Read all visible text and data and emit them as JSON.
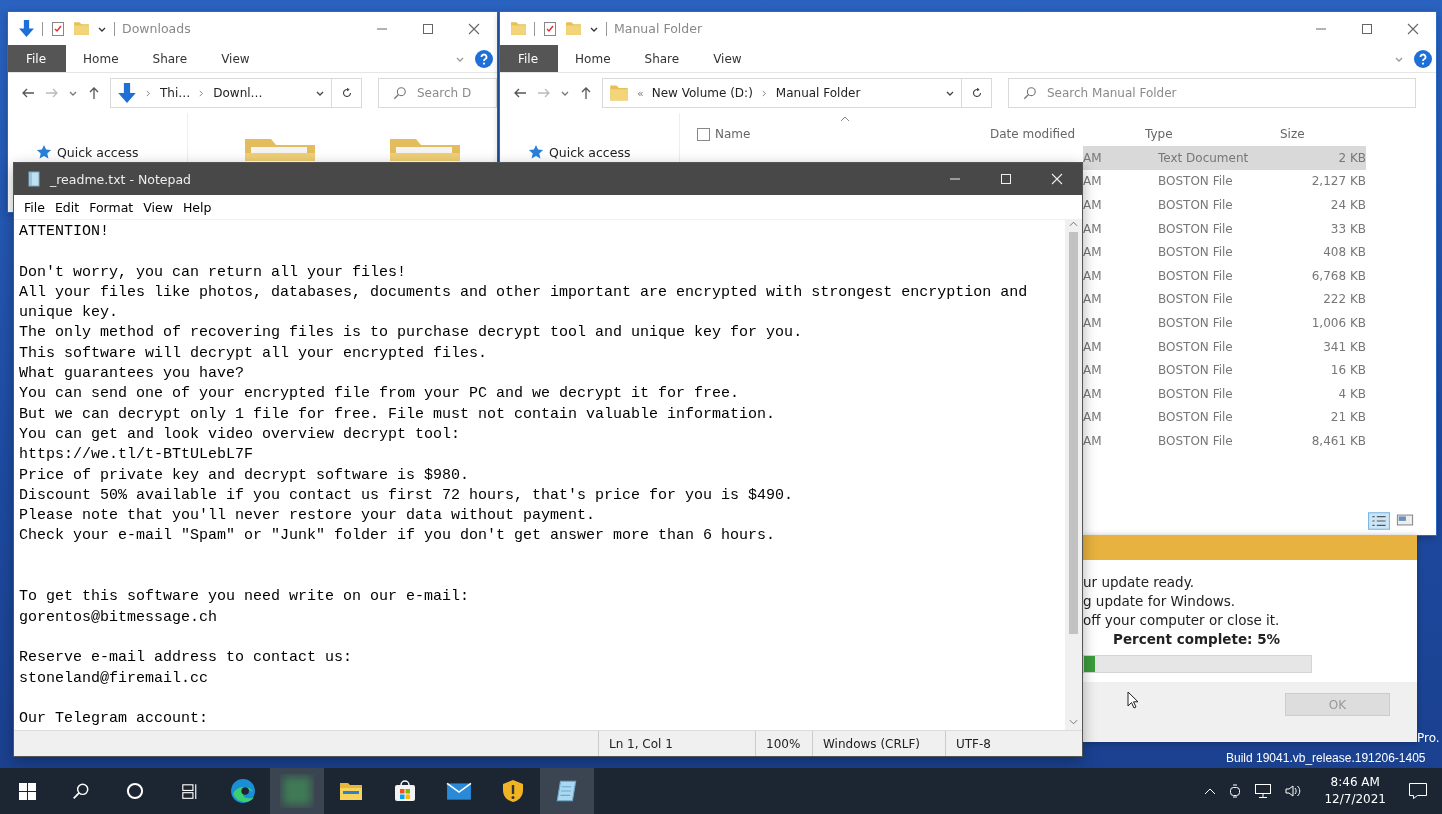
{
  "explorer_windows": [
    {
      "kind": "icons",
      "title": "Downloads",
      "ribbon": [
        {
          "label": "File",
          "kind": "file"
        },
        {
          "label": "Home",
          "kind": "tab"
        },
        {
          "label": "Share",
          "kind": "tab"
        },
        {
          "label": "View",
          "kind": "tab"
        }
      ],
      "path": [
        "Thi…",
        "Downl…"
      ],
      "search_placeholder": "Search D",
      "nav": [
        "Quick access"
      ]
    },
    {
      "kind": "details",
      "title": "Manual Folder",
      "select_all_checked": false,
      "ribbon": [
        {
          "label": "File",
          "kind": "file"
        },
        {
          "label": "Home",
          "kind": "tab"
        },
        {
          "label": "Share",
          "kind": "tab"
        },
        {
          "label": "View",
          "kind": "tab"
        }
      ],
      "path_prefix": "«",
      "path": [
        "New Volume (D:)",
        "Manual Folder"
      ],
      "search_placeholder": "Search Manual Folder",
      "nav": [
        "Quick access"
      ],
      "columns": [
        "Name",
        "Date modified",
        "Type",
        "Size"
      ],
      "rows": [
        {
          "date": "AM",
          "type": "Text Document",
          "size": "2 KB",
          "selected": true
        },
        {
          "date": "AM",
          "type": "BOSTON File",
          "size": "2,127 KB",
          "selected": false
        },
        {
          "date": "AM",
          "type": "BOSTON File",
          "size": "24 KB",
          "selected": false
        },
        {
          "date": "AM",
          "type": "BOSTON File",
          "size": "33 KB",
          "selected": false
        },
        {
          "date": "AM",
          "type": "BOSTON File",
          "size": "408 KB",
          "selected": false
        },
        {
          "date": "AM",
          "type": "BOSTON File",
          "size": "6,768 KB",
          "selected": false
        },
        {
          "date": "AM",
          "type": "BOSTON File",
          "size": "222 KB",
          "selected": false
        },
        {
          "date": "AM",
          "type": "BOSTON File",
          "size": "1,006 KB",
          "selected": false
        },
        {
          "date": "AM",
          "type": "BOSTON File",
          "size": "341 KB",
          "selected": false
        },
        {
          "date": "AM",
          "type": "BOSTON File",
          "size": "16 KB",
          "selected": false
        },
        {
          "date": "AM",
          "type": "BOSTON File",
          "size": "4 KB",
          "selected": false
        },
        {
          "date": "AM",
          "type": "BOSTON File",
          "size": "21 KB",
          "selected": false
        },
        {
          "date": "AM",
          "type": "BOSTON File",
          "size": "8,461 KB",
          "selected": false
        }
      ]
    }
  ],
  "update_dialog": {
    "lines": [
      "ur update ready.",
      "g update for Windows.",
      "off your computer or close it."
    ],
    "percent": "Percent complete: 5%",
    "level": 0.05,
    "button": {
      "label": "OK",
      "disabled": true
    }
  },
  "notepad": {
    "title": "_readme.txt - Notepad",
    "menu": [
      "File",
      "Edit",
      "Format",
      "View",
      "Help"
    ],
    "blocks": [
      {
        "kind": "first",
        "lines": [
          "ATTENTION!"
        ]
      },
      {
        "kind": "para",
        "lines": [
          "Don't worry, you can return all your files!",
          "All your files like photos, databases, documents and other important are encrypted with strongest encryption and",
          "unique key.",
          "The only method of recovering files is to purchase decrypt tool and unique key for you.",
          "This software will decrypt all your encrypted files.",
          "What guarantees you have?",
          "You can send one of your encrypted file from your PC and we decrypt it for free.",
          "But we can decrypt only 1 file for free. File must not contain valuable information.",
          "You can get and look video overview decrypt tool:",
          "https://we.tl/t-BTtULebL7F",
          "Price of private key and decrypt software is $980.",
          "Discount 50% available if you contact us first 72 hours, that's price for you is $490.",
          "Please note that you'll never restore your data without payment.",
          "Check your e-mail \"Spam\" or \"Junk\" folder if you don't get answer more than 6 hours."
        ]
      },
      {
        "kind": "section",
        "lines": [
          "To get this software you need write on our e-mail:",
          "gorentos@bitmessage.ch"
        ]
      },
      {
        "kind": "para",
        "lines": [
          "Reserve e-mail address to contact us:",
          "stoneland@firemail.cc"
        ]
      },
      {
        "kind": "para",
        "lines": [
          "Our Telegram account:"
        ]
      }
    ],
    "status": [
      "Ln 1, Col 1",
      "100%",
      "Windows (CRLF)",
      "UTF-8"
    ]
  },
  "desktop": {
    "edition": "Pro.",
    "build": "Build 19041.vb_release.191206-1405"
  },
  "taskbar": {
    "apps": [
      {
        "kind": "start",
        "active": false
      },
      {
        "kind": "search",
        "active": false
      },
      {
        "kind": "cortana",
        "active": false
      },
      {
        "kind": "taskview",
        "active": false
      },
      {
        "kind": "edge",
        "active": false
      },
      {
        "kind": "blurred",
        "active": true
      },
      {
        "kind": "explorer",
        "active": false
      },
      {
        "kind": "store",
        "active": false
      },
      {
        "kind": "mail",
        "active": false
      },
      {
        "kind": "shield",
        "active": false
      },
      {
        "kind": "notepad",
        "active": true
      }
    ],
    "time": "8:46 AM",
    "date": "12/7/2021"
  }
}
